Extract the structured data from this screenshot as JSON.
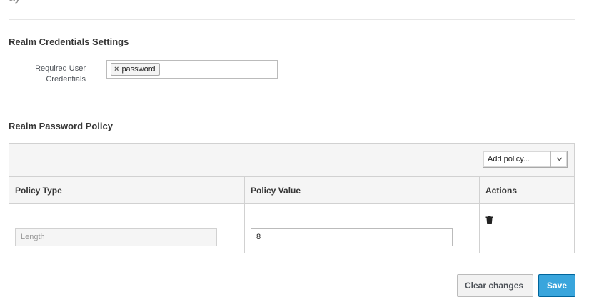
{
  "credentials": {
    "title": "Realm Credentials Settings",
    "required_label_line1": "Required User",
    "required_label_line2": "Credentials",
    "tags": [
      {
        "label": "password",
        "remove_symbol": "×"
      }
    ]
  },
  "policy": {
    "title": "Realm Password Policy",
    "add_select": {
      "value": "Add policy...",
      "icon": "chevron-down-icon"
    },
    "columns": [
      "Policy Type",
      "Policy Value",
      "Actions"
    ],
    "rows": [
      {
        "type": "Length",
        "value": "8",
        "action_icon": "trash-icon"
      }
    ]
  },
  "actions": {
    "clear": "Clear changes",
    "save": "Save"
  }
}
